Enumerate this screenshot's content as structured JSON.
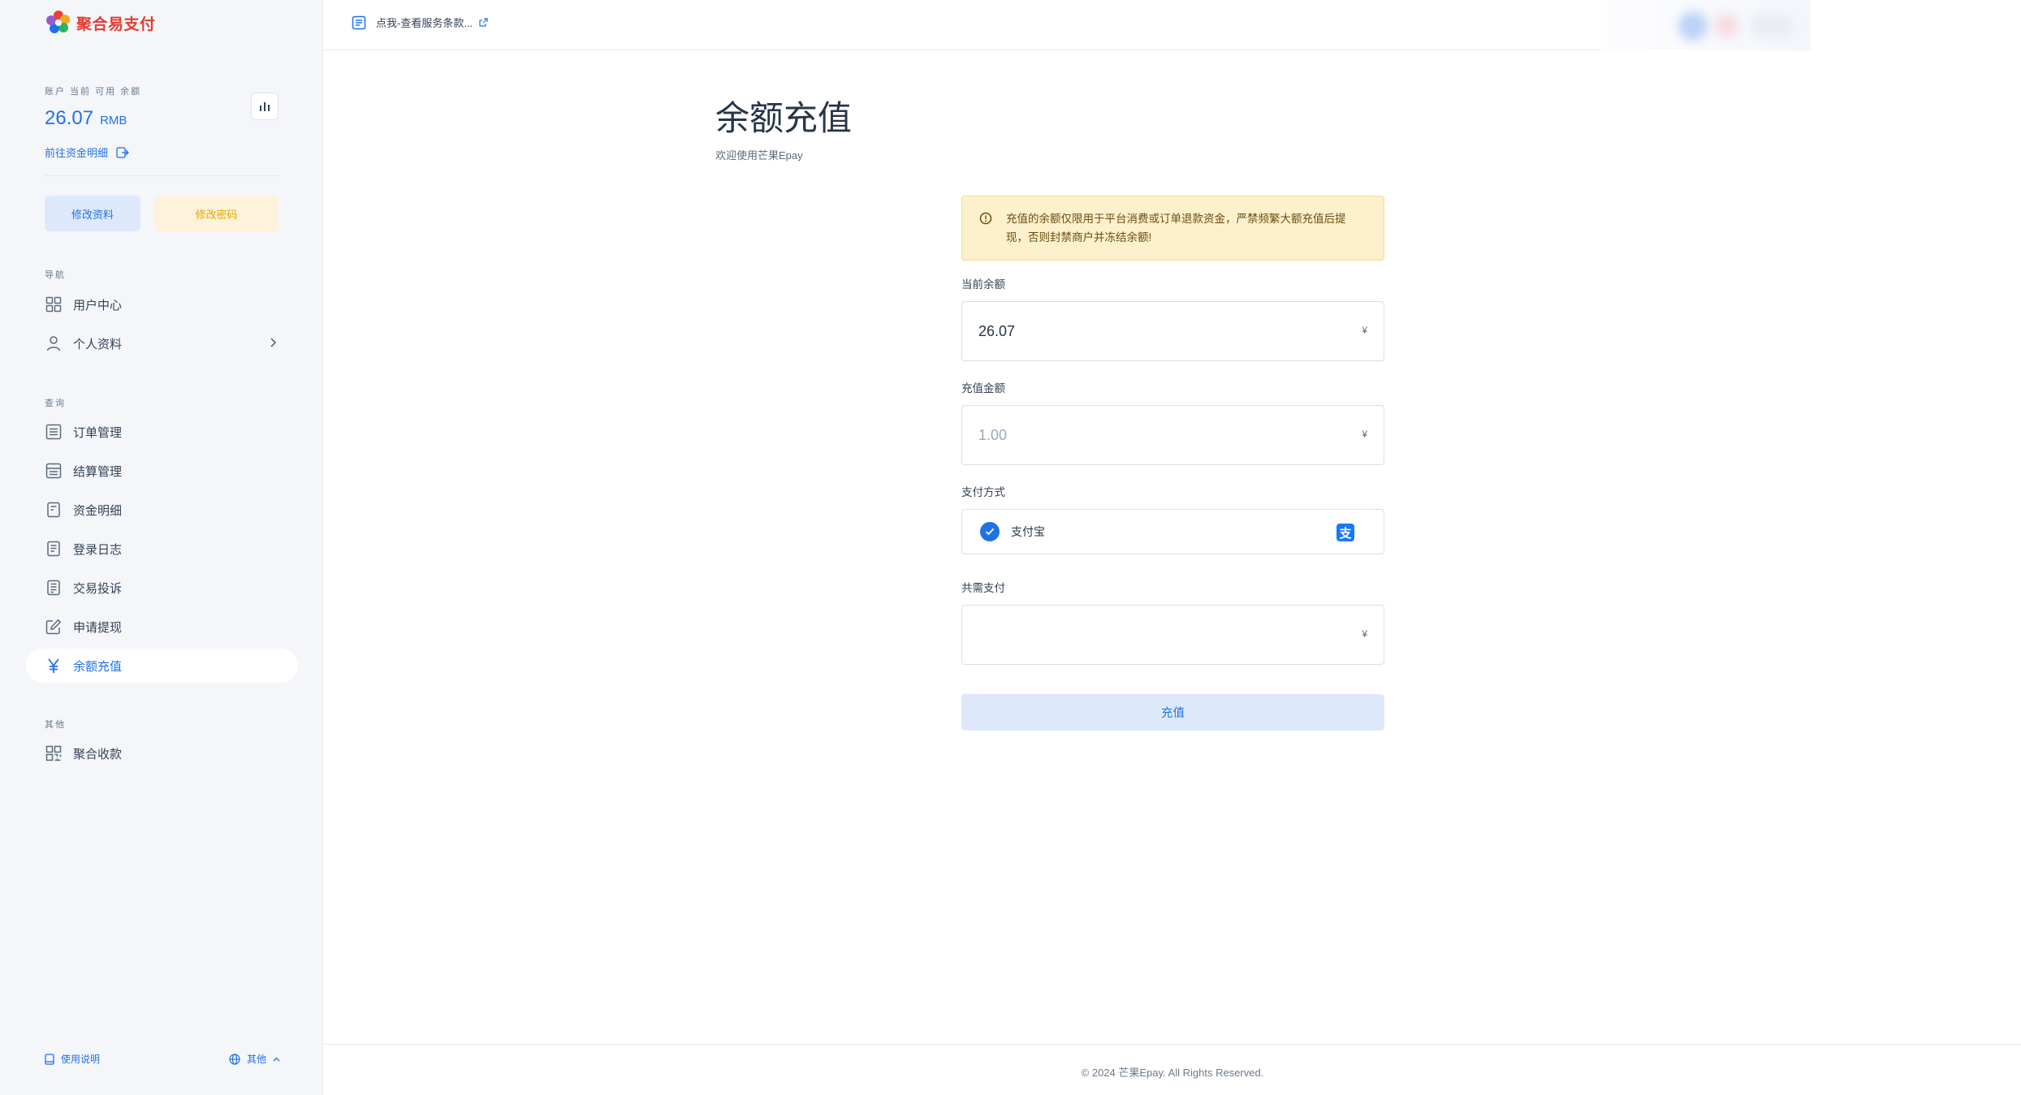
{
  "brand": {
    "name": "聚合易支付"
  },
  "balance": {
    "label": "账户 当前 可用 余额",
    "amount": "26.07",
    "unit": "RMB",
    "detail_link": "前往资金明细"
  },
  "profile_buttons": {
    "edit_profile": "修改资料",
    "edit_password": "修改密码"
  },
  "nav_sections": {
    "nav": "导航",
    "query": "查询",
    "other": "其他"
  },
  "nav": {
    "user_center": "用户中心",
    "personal_info": "个人资料",
    "orders": "订单管理",
    "settlement": "结算管理",
    "fund_detail": "资金明细",
    "login_log": "登录日志",
    "complaints": "交易投诉",
    "withdraw": "申请提现",
    "recharge": "余额充值",
    "aggregate": "聚合收款"
  },
  "sidebar_footer": {
    "help": "使用说明",
    "other": "其他"
  },
  "topbar": {
    "terms_link": "点我-查看服务条款..."
  },
  "page": {
    "title": "余额充值",
    "subtitle": "欢迎使用芒果Epay"
  },
  "form": {
    "alert": "充值的余额仅限用于平台消费或订单退款资金，严禁频繁大额充值后提现，否则封禁商户并冻结余额!",
    "current_balance_label": "当前余额",
    "current_balance_value": "26.07",
    "amount_label": "充值金额",
    "amount_placeholder": "1.00",
    "currency_suffix": "¥",
    "pay_method_label": "支付方式",
    "pay_method_name": "支付宝",
    "pay_method_icon_char": "支",
    "total_label": "共需支付",
    "total_value": "",
    "submit": "充值"
  },
  "footer": {
    "copyright": "© 2024 芒果Epay. All Rights Reserved."
  },
  "colors": {
    "accent": "#1f72e5",
    "warning_bg": "#fcf0cd",
    "alipay": "#1677ff"
  }
}
